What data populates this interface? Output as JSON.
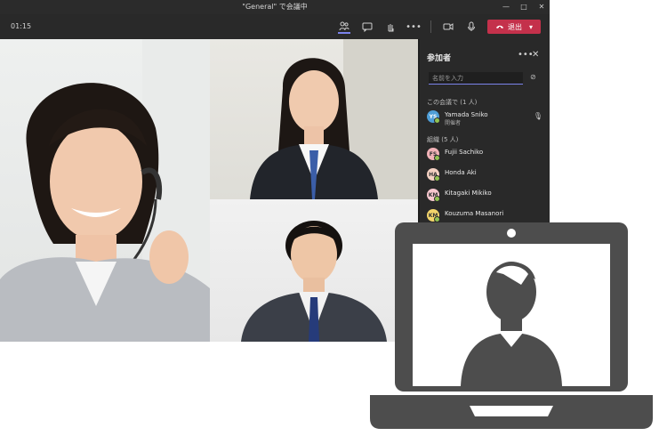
{
  "window": {
    "title": "\"General\" で会議中",
    "controls": [
      "minimize-icon",
      "maximize-icon",
      "close-icon"
    ]
  },
  "toolbar": {
    "timer": "01:15",
    "icons": [
      "participants-icon",
      "chat-icon",
      "raise-hand-icon",
      "more-icon",
      "camera-icon",
      "mic-icon",
      "share-icon"
    ],
    "leave_label": "退出"
  },
  "participants_panel": {
    "title": "参加者",
    "search_placeholder": "名前を入力",
    "in_meeting_label": "この会議で (1 人)",
    "in_meeting": [
      {
        "name": "Yamada Sniko",
        "role": "開催者",
        "initials": "YS",
        "avatar_color": "#4f9fd8"
      }
    ],
    "others_label": "組織 (5 人)",
    "others": [
      {
        "name": "Fujii Sachiko",
        "initials": "FS",
        "avatar_color": "#f2b3b8"
      },
      {
        "name": "Honda Aki",
        "initials": "HA",
        "avatar_color": "#f4d1c2"
      },
      {
        "name": "Kitagaki Mikiko",
        "initials": "KM",
        "avatar_color": "#f7c7cf"
      },
      {
        "name": "Kouzuma Masanori",
        "initials": "KM",
        "avatar_color": "#f3d56b"
      }
    ]
  },
  "colors": {
    "accent": "#7b83eb",
    "leave": "#c4314b",
    "laptop": "#4d4d4d",
    "available": "#92c353"
  }
}
